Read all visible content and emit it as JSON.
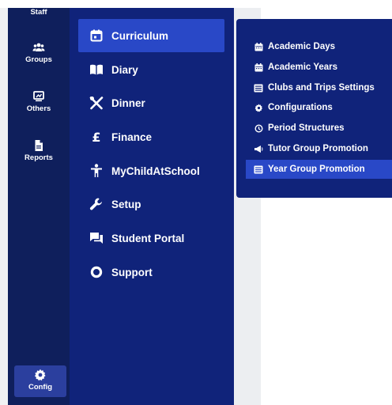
{
  "rail": {
    "items": [
      {
        "label": "Staff"
      },
      {
        "label": "Groups"
      },
      {
        "label": "Others"
      },
      {
        "label": "Reports"
      },
      {
        "label": "Config"
      }
    ]
  },
  "menu": {
    "items": [
      {
        "label": "Curriculum",
        "icon": "calendar-icon"
      },
      {
        "label": "Diary",
        "icon": "book-icon"
      },
      {
        "label": "Dinner",
        "icon": "cutlery-icon"
      },
      {
        "label": "Finance",
        "icon": "pound-icon"
      },
      {
        "label": "MyChildAtSchool",
        "icon": "child-icon"
      },
      {
        "label": "Setup",
        "icon": "wrench-icon"
      },
      {
        "label": "Student Portal",
        "icon": "chat-icon"
      },
      {
        "label": "Support",
        "icon": "ring-icon"
      }
    ]
  },
  "submenu": {
    "items": [
      {
        "label": "Academic Days",
        "icon": "calendar-icon"
      },
      {
        "label": "Academic Years",
        "icon": "calendar-icon"
      },
      {
        "label": "Clubs and Trips Settings",
        "icon": "list-icon"
      },
      {
        "label": "Configurations",
        "icon": "gear-icon"
      },
      {
        "label": "Period Structures",
        "icon": "timer-icon"
      },
      {
        "label": "Tutor Group Promotion",
        "icon": "megaphone-icon"
      },
      {
        "label": "Year Group Promotion",
        "icon": "list-icon"
      }
    ]
  },
  "colors": {
    "rail_bg": "#0f1f5c",
    "menu_bg": "#10237a",
    "active_bg": "#2948c7"
  }
}
